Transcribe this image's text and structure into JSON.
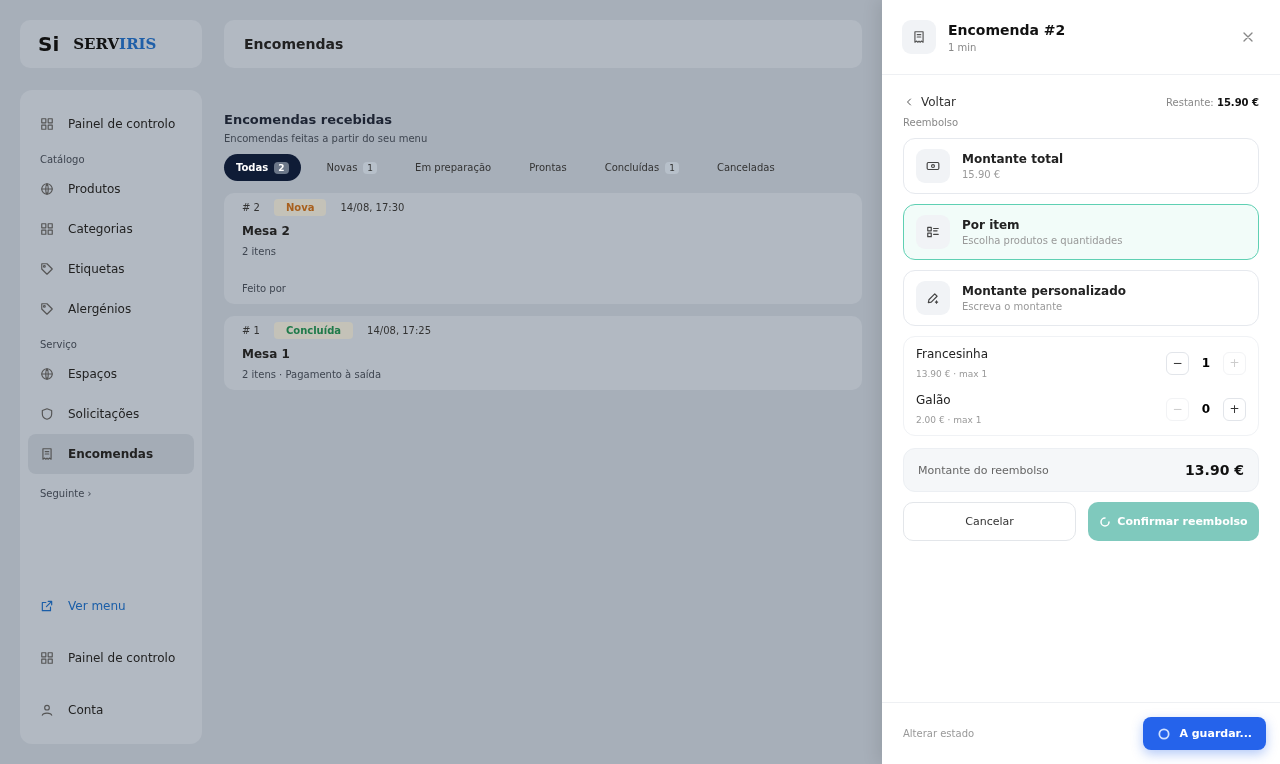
{
  "app": {
    "logo_mark": "Si",
    "brand": [
      "SERV",
      "IRIS"
    ],
    "page_title": "Encomendas"
  },
  "sidebar": {
    "sections": [
      {
        "items": [
          {
            "label": "Painel de controlo",
            "kind": "grid",
            "selected": false
          }
        ]
      },
      {
        "heading": "Catálogo",
        "items": [
          {
            "label": "Produtos",
            "kind": "globe",
            "selected": false
          },
          {
            "label": "Categorias",
            "kind": "grid",
            "selected": false
          },
          {
            "label": "Etiquetas",
            "kind": "tag",
            "selected": false
          },
          {
            "label": "Alergénios",
            "kind": "tag",
            "selected": false
          }
        ]
      },
      {
        "heading": "Serviço",
        "items": [
          {
            "label": "Espaços",
            "kind": "globe",
            "selected": false
          },
          {
            "label": "Solicitações",
            "kind": "shield",
            "selected": false
          },
          {
            "label": "Encomendas",
            "kind": "receipt",
            "selected": true
          }
        ]
      }
    ],
    "more": "Seguinte ›",
    "footer": [
      {
        "label": "Ver menu",
        "kind": "link"
      },
      {
        "label": "Painel de controlo",
        "kind": "grid"
      },
      {
        "label": "Conta",
        "kind": "user"
      }
    ]
  },
  "orders": {
    "title": "Encomendas recebidas",
    "subtitle": "Encomendas feitas a partir do seu menu",
    "filters": [
      {
        "label": "Todas",
        "count": "2",
        "selected": true
      },
      {
        "label": "Novas",
        "count": "1",
        "selected": false
      },
      {
        "label": "Em preparação",
        "selected": false
      },
      {
        "label": "Prontas",
        "selected": false
      },
      {
        "label": "Concluídas",
        "count": "1",
        "selected": false
      },
      {
        "label": "Canceladas",
        "selected": false
      }
    ],
    "list": [
      {
        "number": "# 2",
        "status": "Nova",
        "color": "#a85f1c",
        "time": "14/08, 17:30",
        "table": "Mesa 2",
        "detail": "2 itens",
        "footer": "Feito por"
      },
      {
        "number": "# 1",
        "status": "Concluída",
        "color": "#1f7a4a",
        "time": "14/08, 17:25",
        "table": "Mesa 1",
        "detail": "2 itens · Pagamento à saída"
      }
    ]
  },
  "panel": {
    "title": "Encomenda #2",
    "subtitle": "1 min",
    "back": "Voltar",
    "remaining_label": "Restante:",
    "remaining_value": "15.90 €",
    "section": "Reembolso",
    "options": [
      {
        "title": "Montante total",
        "subtitle": "15.90 €",
        "kind": "cash",
        "selected": false
      },
      {
        "title": "Por item",
        "subtitle": "Escolha produtos e quantidades",
        "kind": "list",
        "selected": true
      },
      {
        "title": "Montante personalizado",
        "subtitle": "Escreva o montante",
        "kind": "pen",
        "selected": false
      }
    ],
    "items": [
      {
        "name": "Francesinha",
        "meta": "13.90 € · max 1",
        "minus": "−",
        "qty": "1",
        "plus": "+",
        "minus_disabled": false,
        "plus_disabled": true
      },
      {
        "name": "Galão",
        "meta": "2.00 € · max 1",
        "minus": "−",
        "qty": "0",
        "plus": "+",
        "minus_disabled": true,
        "plus_disabled": false
      }
    ],
    "total_label": "Montante do reembolso",
    "total_value": "13.90 €",
    "cancel": "Cancelar",
    "confirm": "Confirmar reembolso",
    "confirm_loading": true,
    "footer_label": "Alterar estado",
    "toast": "A guardar..."
  }
}
